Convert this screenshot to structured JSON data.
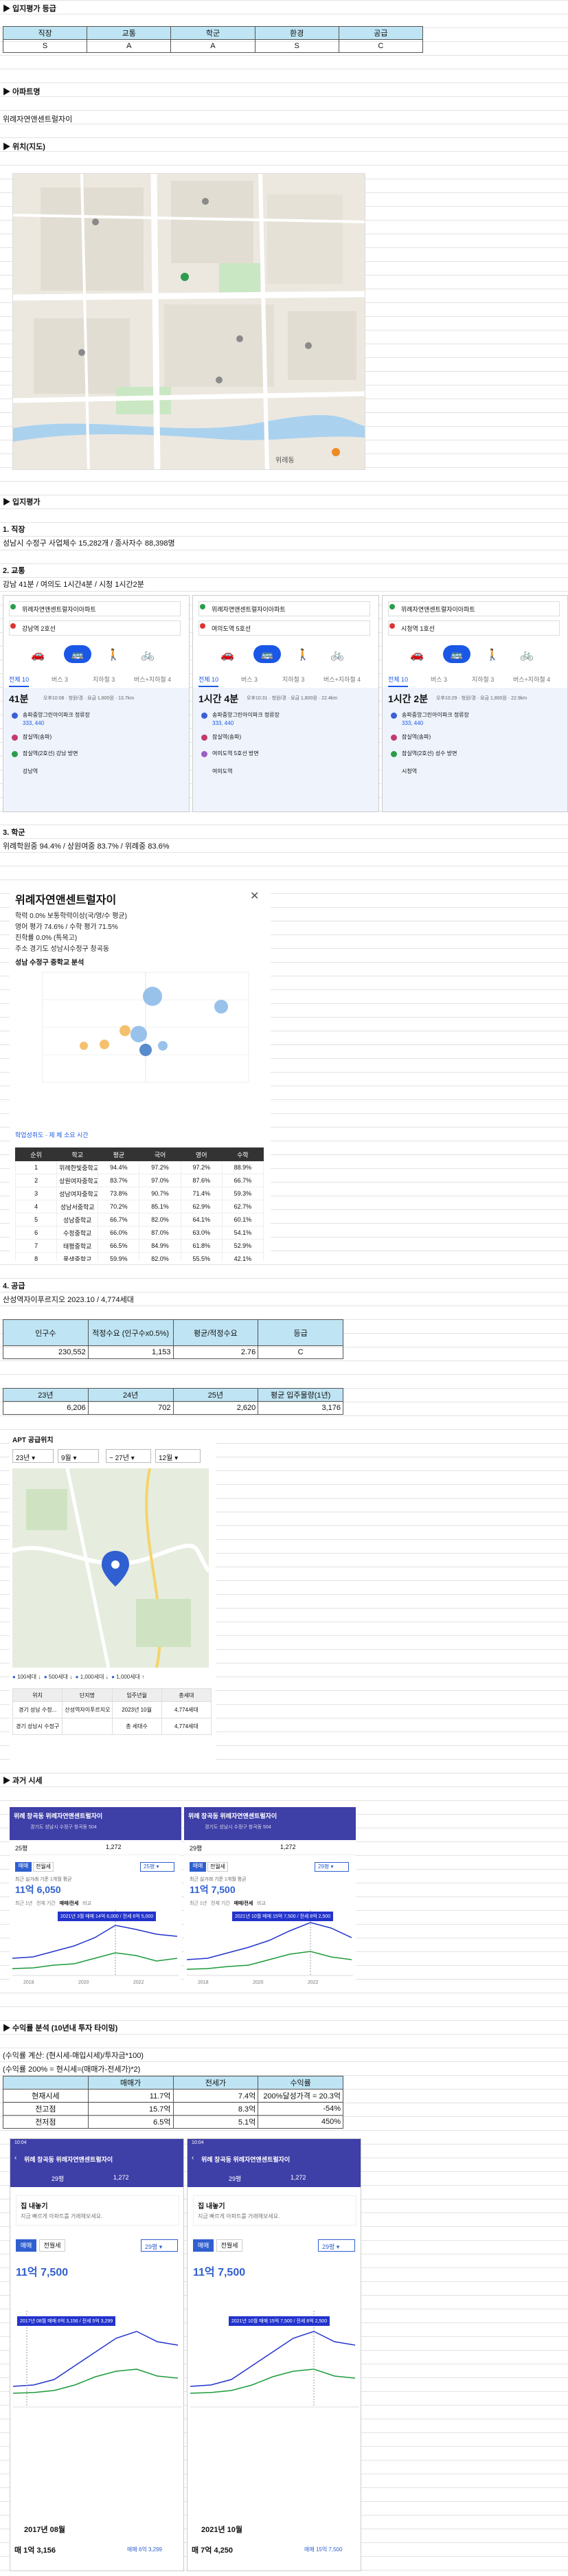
{
  "colors": {
    "sheet_header": "#bfe4f3",
    "app_purple": "#3f3fa8",
    "app_blue": "#2f5fd0",
    "line_blue": "#2233cc",
    "line_green": "#1b9a3a",
    "primary_blue": "#1a57e6"
  },
  "grade": {
    "title": "▶ 입지평가 등급",
    "headers": [
      "직장",
      "교통",
      "학군",
      "환경",
      "공급"
    ],
    "values": [
      "S",
      "A",
      "A",
      "S",
      "C"
    ]
  },
  "apartment": {
    "title": "▶ 아파트명",
    "name": "위례자연앤센트럴자이"
  },
  "location": {
    "title": "▶ 위치(지도)",
    "map_labels": [
      "위례동"
    ]
  },
  "evaluation": {
    "title": "▶ 입지평가",
    "job": {
      "title": "1. 직장",
      "text": "성남시 수정구 사업체수 15,282개 / 종사자수 88,398명"
    },
    "transport": {
      "title": "2. 교통",
      "text": "강남 41분 / 여의도 1시간4분 / 시청 1시간2분",
      "routes": [
        {
          "from": "위례자연앤센트럴자이아파트",
          "to": "강남역 2호선",
          "time": "41분",
          "detail": "오후10:08 · 청원/경 · 요금 1,800원 · 13.7km",
          "steps": [
            "송파중앙그린아이파크 정류장",
            "333, 440",
            "잠실역(송파)",
            "잠실역(2호선) 강남 방면",
            "강남역"
          ]
        },
        {
          "from": "위례자연앤센트럴자이아파트",
          "to": "여의도역 5호선",
          "time": "1시간 4분",
          "detail": "오후10:31 · 청원/경 · 요금 1,800원 · 22.4km",
          "steps": [
            "송파중앙그린아이파크 정류장",
            "333, 440",
            "잠실역(송파)",
            "여의도역 5호선 방면",
            "여의도역"
          ]
        },
        {
          "from": "위례자연앤센트럴자이아파트",
          "to": "시청역 1호선",
          "time": "1시간 2분",
          "detail": "오후10:29 · 청원/경 · 요금 1,800원 · 22.9km",
          "steps": [
            "송파중앙그린아이파크 정류장",
            "333, 440",
            "잠실역(송파)",
            "잠실역(2호선) 성수 방면",
            "시청역"
          ]
        }
      ],
      "tabs": [
        "전체 10",
        "버스 3",
        "지하철 3",
        "버스+지하철 4"
      ]
    },
    "school": {
      "title": "3. 학군",
      "text": "위례학원중 94.4% / 상원여중 83.7% / 위례중 83.6%",
      "popup": {
        "title": "위례자연앤센트럴자이",
        "lines": [
          "학력 0.0% 보통학력이상(국/영/수 평균)",
          "영어 평가 74.6% / 수학 평가 71.5%",
          "진학률 0.0% (특목고)",
          "주소 경기도 성남시수정구 창곡동"
        ],
        "section": "성남 수정구 중학교 분석",
        "table_headers": [
          "순위",
          "학교",
          "평균",
          "국어",
          "영어",
          "수학"
        ],
        "rows": [
          [
            "1",
            "위례한빛중학교",
            "94.4%",
            "97.2%",
            "97.2%",
            "88.9%"
          ],
          [
            "2",
            "상원여자중학교",
            "83.7%",
            "97.0%",
            "87.6%",
            "66.7%"
          ],
          [
            "3",
            "성남여자중학교",
            "73.8%",
            "90.7%",
            "71.4%",
            "59.3%"
          ],
          [
            "4",
            "성남서중학교",
            "70.2%",
            "85.1%",
            "62.9%",
            "62.7%"
          ],
          [
            "5",
            "성남중학교",
            "66.7%",
            "82.0%",
            "64.1%",
            "60.1%"
          ],
          [
            "6",
            "수정중학교",
            "66.0%",
            "87.0%",
            "63.0%",
            "54.1%"
          ],
          [
            "7",
            "태평중학교",
            "66.5%",
            "84.9%",
            "61.8%",
            "52.9%"
          ],
          [
            "8",
            "풍생중학교",
            "59.9%",
            "82.0%",
            "55.5%",
            "42.1%"
          ]
        ],
        "footnote": "학업성취도 · 제 체 소요 시간"
      }
    },
    "supply": {
      "title": "4. 공급",
      "text": "산성역자이푸르지오 2023.10 / 4,774세대",
      "table1": {
        "headers": [
          "인구수",
          "적정수요 (인구수x0.5%)",
          "평균/적정수요",
          "등급"
        ],
        "values": [
          "230,552",
          "1,153",
          "2.76",
          "C"
        ]
      },
      "table2": {
        "headers": [
          "23년",
          "24년",
          "25년",
          "평균 입주물량(1년)"
        ],
        "values": [
          "6,206",
          "702",
          "2,620",
          "3,176"
        ]
      },
      "apt_title": "APT 공급위치",
      "selectors": [
        "23년",
        "9월",
        "~ 27년",
        "12월"
      ],
      "legend": [
        "100세대 ↓",
        "500세대 ↓",
        "1,000세대 ↓",
        "1,000세대 ↑"
      ],
      "list_headers": [
        "위치",
        "단지명",
        "입주년월",
        "총세대"
      ],
      "list": [
        [
          "경기 성남 수정...",
          "산성역자이푸르지오",
          "2023년 10월",
          "4,774세대"
        ],
        [
          "경기 성남시 수정구",
          "",
          "총 세대수",
          "4,774세대"
        ]
      ]
    }
  },
  "past": {
    "title": "▶ 과거 시세",
    "screens": [
      {
        "header": "위례 창곡동 위례자연앤센트럴자이",
        "sub": "경기도 성남시 수정구 창곡동 504",
        "area": "25평",
        "likes": "1,272",
        "type_tabs": [
          "매매",
          "전월세"
        ],
        "select": "25평",
        "price_label": "최근 실거래 기준 1개월 평균",
        "price": "11억 6,050",
        "period_tabs": [
          "최근 1년",
          "전체 기간",
          "매매/전세",
          "비교"
        ],
        "tooltip": "2021년 3월 매매 14억 6,000 / 전세 6억 5,000",
        "years": [
          "2018",
          "2020",
          "2022"
        ]
      },
      {
        "header": "위례 창곡동 위례자연앤센트럴자이",
        "sub": "경기도 성남시 수정구 창곡동 504",
        "area": "29평",
        "likes": "1,272",
        "type_tabs": [
          "매매",
          "전월세"
        ],
        "select": "29평",
        "price_label": "최근 실거래 기준 1개월 평균",
        "price": "11억 7,500",
        "period_tabs": [
          "최근 1년",
          "전체 기간",
          "매매/전세",
          "비교"
        ],
        "tooltip": "2021년 10월 매매 15억 7,500 / 전세 8억 2,500",
        "years": [
          "2018",
          "2020",
          "2022"
        ]
      }
    ]
  },
  "returns": {
    "title": "▶ 수익률 분석 (10년내 투자 타이밍)",
    "formula1": "(수익률 계산: (현시세-매입시세)/투자금*100)",
    "formula2": "(수익률 200% = 현시세=(매매가-전세가)*2)",
    "headers": [
      "",
      "매매가",
      "전세가",
      "수익률"
    ],
    "rows": [
      [
        "현재시세",
        "11.7억",
        "7.4억",
        "200%달성가격 = 20.3억"
      ],
      [
        "전고점",
        "15.7억",
        "8.3억",
        "-54%"
      ],
      [
        "전저점",
        "6.5억",
        "5.1억",
        "450%"
      ]
    ]
  },
  "phones": [
    {
      "status": "10:04",
      "header": "위례 창곡동 위례자연앤센트럴자이",
      "area": "29평",
      "likes": "1,272",
      "banner": "집 내놓기",
      "banner_sub": "지금 빠르게 아파트를 거래해보세요.",
      "type_tabs": [
        "매매",
        "전월세"
      ],
      "select": "29평",
      "price": "11억 7,500",
      "tooltip": "2017년 08월 매매 6억 3,156 / 전세 5억 3,299",
      "date": "2017년 08월",
      "bottom": "매 1억 3,156",
      "bottom_right": "매매 6억 3,299"
    },
    {
      "status": "10:04",
      "header": "위례 창곡동 위례자연앤센트럴자이",
      "area": "29평",
      "likes": "1,272",
      "banner": "집 내놓기",
      "banner_sub": "지금 빠르게 아파트를 거래해보세요.",
      "type_tabs": [
        "매매",
        "전월세"
      ],
      "select": "29평",
      "price": "11억 7,500",
      "tooltip": "2021년 10월 매매 15억 7,500 / 전세 8억 2,500",
      "date": "2021년 10월",
      "bottom": "매 7억 4,250",
      "bottom_right": "매매 15억 7,500"
    }
  ]
}
